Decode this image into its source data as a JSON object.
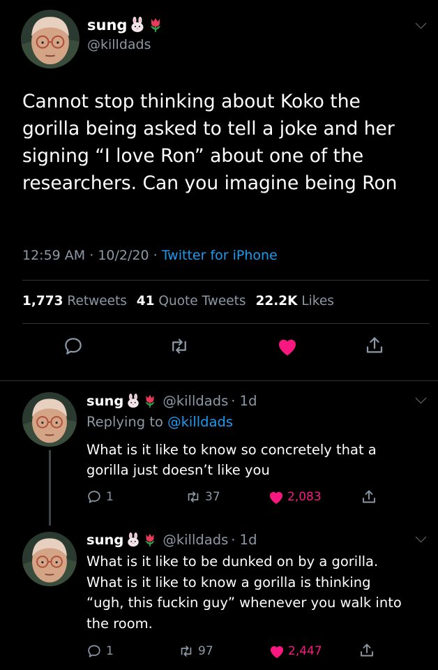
{
  "main_tweet": {
    "author_name": "sung",
    "handle": "@killdads",
    "text_lines": [
      "Cannot stop thinking about Koko the",
      "gorilla being asked to tell a joke and her",
      "signing “I love Ron” about one of the",
      "researchers. Can you imagine being Ron"
    ],
    "time": "12:59 AM",
    "sep1": "·",
    "date": "10/2/20",
    "sep2": "·",
    "source": "Twitter for iPhone",
    "retweets_count": "1,773",
    "retweets_label": "Retweets",
    "quotes_count": "41",
    "quotes_label": "Quote Tweets",
    "likes_count": "22.2K",
    "likes_label": "Likes"
  },
  "reply1": {
    "author_name": "sung",
    "handle": "@killdads",
    "time": "· 1d",
    "replying_prefix": "Replying to",
    "replying_handle": "@killdads",
    "text_lines": [
      "What is it like to know so concretely that a",
      "gorilla just doesn’t like you"
    ],
    "replies": "1",
    "retweets": "37",
    "likes": "2,083"
  },
  "reply2": {
    "author_name": "sung",
    "handle": "@killdads",
    "time": "· 1d",
    "text_lines": [
      "What is it like to be dunked on by a gorilla.",
      "What is it like to know a gorilla is thinking",
      "“ugh, this fuckin guy” whenever you walk into",
      "the room."
    ],
    "replies": "1",
    "retweets": "97",
    "likes": "2,447"
  },
  "colors": {
    "background": "#000000",
    "link_blue": "#1d9bf0",
    "like_red": "#f91880",
    "muted_gray": "#8b98a5"
  },
  "icons": [
    "reply-icon",
    "retweet-icon",
    "like-icon",
    "share-icon",
    "rabbit-emoji",
    "tulip-emoji",
    "chevron-down-icon"
  ]
}
